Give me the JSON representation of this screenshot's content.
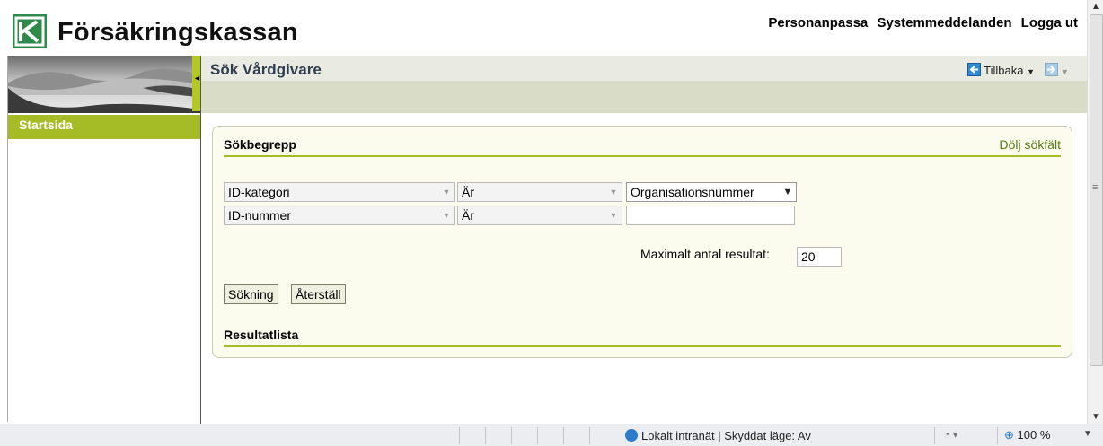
{
  "header": {
    "brand": "Försäkringskassan",
    "links": [
      "Personanpassa",
      "Systemmeddelanden",
      "Logga ut"
    ]
  },
  "sidebar": {
    "items": [
      {
        "label": "Startsida"
      }
    ]
  },
  "page": {
    "title": "Sök Vårdgivare",
    "back_label": "Tillbaka"
  },
  "search": {
    "section_title": "Sökbegrepp",
    "hide_link": "Dölj sökfält",
    "rows": [
      {
        "field": "ID-kategori",
        "operator": "Är",
        "value": "Organisationsnummer"
      },
      {
        "field": "ID-nummer",
        "operator": "Är",
        "value": ""
      }
    ],
    "max_label": "Maximalt antal resultat:",
    "max_value": "20",
    "search_button": "Sökning",
    "reset_button": "Återställ",
    "results_title": "Resultatlista"
  },
  "statusbar": {
    "zone": "Lokalt intranät | Skyddat läge: Av",
    "zoom": "100 %"
  },
  "colors": {
    "accent_green": "#a6bc27",
    "logo_green": "#2d8a48",
    "panel_bg": "#fbfbee"
  },
  "icons": [
    "logo-icon",
    "back-arrow-icon",
    "forward-arrow-icon",
    "globe-icon",
    "zoom-icon"
  ]
}
